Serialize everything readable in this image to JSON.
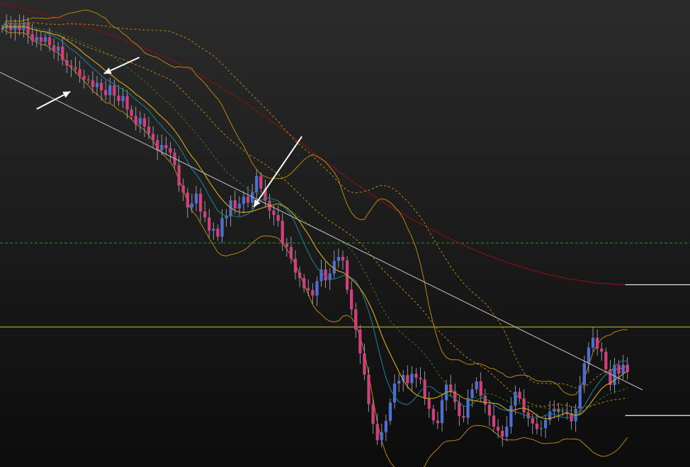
{
  "colors": {
    "background_top": "#2b2b2b",
    "background_bottom": "#0c0c0c",
    "candle_up": "#4f6fd0",
    "candle_down": "#d0407a",
    "wick": "#b0b0c8",
    "bollinger": "#b8860b",
    "slow_ma": "#7a1414",
    "mid_ma": "#c8a020",
    "signal_ma": "#3a7a20",
    "fast_ma": "#1c7c8c",
    "trendline": "#b4b4b4",
    "support_level": "#d2c238",
    "dashed_level": "#2f8a2f",
    "marker": "#f0f0f0",
    "annotation_arrow": "#ffffff"
  },
  "chart_data": {
    "type": "candlestick",
    "grid": false,
    "legend": "none",
    "x_range": [
      0,
      160
    ],
    "y_range": [
      0,
      100
    ],
    "closes": [
      95.2,
      96.4,
      94.9,
      96.2,
      94.9,
      96.5,
      94.0,
      92.5,
      93.3,
      92.3,
      93.3,
      91.5,
      90.3,
      91.2,
      88.2,
      87.0,
      86.6,
      86.2,
      84.7,
      83.9,
      83.7,
      82.2,
      83.1,
      81.5,
      80.4,
      82.6,
      80.3,
      79.1,
      80.2,
      77.2,
      75.8,
      73.9,
      75.3,
      73.4,
      71.8,
      70.4,
      68.1,
      69.3,
      68.6,
      67.6,
      64.8,
      60.3,
      58.7,
      55.4,
      56.3,
      58.5,
      54.5,
      53.2,
      50.2,
      50.7,
      48.9,
      53.0,
      53.5,
      57.0,
      55.2,
      56.2,
      57.8,
      56.5,
      58.8,
      62.4,
      59.6,
      56.9,
      54.7,
      53.7,
      52.4,
      47.4,
      46.6,
      44.0,
      40.9,
      39.7,
      37.4,
      37.0,
      35.8,
      39.0,
      41.6,
      39.2,
      40.7,
      43.5,
      44.4,
      43.6,
      37.1,
      32.7,
      28.2,
      22.9,
      18.2,
      11.6,
      7.2,
      3.6,
      5.4,
      7.9,
      12.0,
      16.2,
      16.8,
      18.1,
      16.3,
      18.4,
      17.5,
      17.1,
      13.0,
      10.6,
      8.0,
      7.4,
      12.5,
      16.0,
      14.5,
      12.1,
      9.0,
      8.6,
      13.0,
      14.9,
      16.7,
      13.5,
      11.5,
      9.1,
      6.6,
      5.7,
      4.4,
      6.6,
      11.3,
      14.4,
      12.9,
      9.8,
      8.5,
      7.3,
      6.1,
      6.3,
      8.1,
      10.0,
      10.6,
      9.9,
      10.0,
      9.6,
      7.8,
      10.6,
      15.8,
      20.7,
      24.2,
      26.4,
      24.0,
      23.3,
      19.4,
      15.9,
      20.4,
      18.4,
      20.4,
      18.8
    ],
    "sma_slow": [
      100.8,
      100.6,
      100.3,
      100.1,
      99.8,
      99.6,
      99.3,
      99.1,
      98.8,
      98.5,
      98.3,
      98.0,
      97.8,
      97.5,
      97.3,
      97.0,
      96.7,
      96.4,
      96.1,
      95.8,
      95.5,
      95.2,
      94.9,
      94.5,
      94.2,
      93.8,
      93.5,
      93.2,
      92.8,
      92.4,
      92.0,
      91.6,
      91.2,
      90.8,
      90.4,
      90.0,
      89.6,
      89.2,
      88.8,
      88.3,
      87.9,
      87.4,
      86.9,
      86.4,
      85.9,
      85.4,
      84.9,
      84.3,
      83.8,
      83.2,
      82.6,
      82.0,
      81.4,
      80.8,
      80.2,
      79.6,
      78.9,
      78.3,
      77.6,
      76.9,
      76.3,
      75.6,
      74.9,
      74.2,
      73.5,
      72.8,
      72.1,
      71.4,
      70.7,
      70.0,
      69.3,
      68.5,
      67.8,
      67.1,
      66.3,
      65.6,
      64.9,
      64.2,
      63.5,
      62.8,
      62.1,
      61.4,
      60.7,
      60.1,
      59.4,
      58.7,
      58.1,
      57.4,
      56.8,
      56.2,
      55.6,
      55.0,
      54.5,
      53.9,
      53.4,
      52.8,
      52.3,
      51.8,
      51.3,
      50.8,
      50.3,
      49.8,
      49.3,
      48.8,
      48.4,
      47.9,
      47.5,
      47.1,
      46.6,
      46.2,
      45.8,
      45.4,
      45.0,
      44.6,
      44.3,
      43.9,
      43.6,
      43.2,
      42.9,
      42.6,
      42.3,
      42.0,
      41.7,
      41.4,
      41.2,
      40.9,
      40.7,
      40.4,
      40.2,
      40.0,
      39.8,
      39.6,
      39.4,
      39.3,
      39.1,
      39.0,
      38.9,
      38.7,
      38.6,
      38.5,
      38.5,
      38.4,
      38.3,
      38.3,
      38.2,
      38.2
    ],
    "trendline": {
      "start": [
        0,
        85.5
      ],
      "end": [
        149,
        14.8
      ]
    },
    "horizontal_levels": [
      {
        "y": 28.8,
        "style": "solid"
      },
      {
        "y": 47.5,
        "style": "dashed"
      }
    ],
    "markers": [
      {
        "x1": 145,
        "x2": 160,
        "y": 38.2
      },
      {
        "x1": 145,
        "x2": 160,
        "y": 9.1
      }
    ],
    "annotation_arrows": [
      {
        "from": [
          32.3,
          88.8
        ],
        "to": [
          24.1,
          85.2
        ]
      },
      {
        "from": [
          8.5,
          77.3
        ],
        "to": [
          16.3,
          81.2
        ]
      },
      {
        "from": [
          70.0,
          71.2
        ],
        "to": [
          58.8,
          55.5
        ]
      }
    ]
  }
}
